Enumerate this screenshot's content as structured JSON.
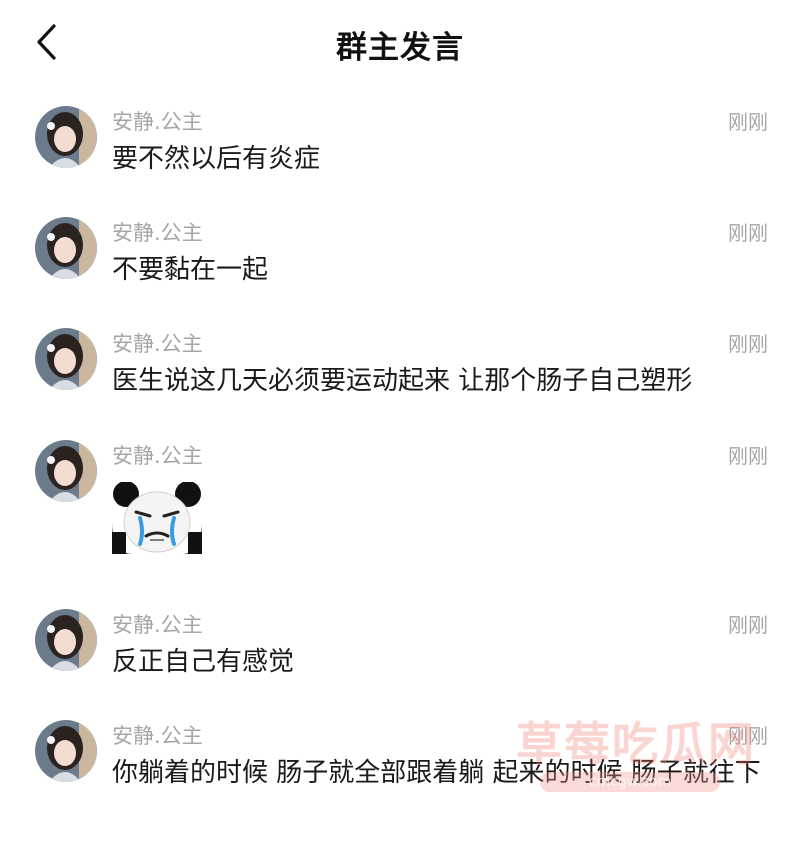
{
  "header": {
    "title": "群主发言"
  },
  "messages": [
    {
      "name": "安静.公主",
      "time": "刚刚",
      "type": "text",
      "text": "要不然以后有炎症"
    },
    {
      "name": "安静.公主",
      "time": "刚刚",
      "type": "text",
      "text": "不要黏在一起"
    },
    {
      "name": "安静.公主",
      "time": "刚刚",
      "type": "text",
      "text": "医生说这几天必须要运动起来 让那个肠子自己塑形"
    },
    {
      "name": "安静.公主",
      "time": "刚刚",
      "type": "sticker",
      "sticker": "panda-crying-meme"
    },
    {
      "name": "安静.公主",
      "time": "刚刚",
      "type": "text",
      "text": "反正自己有感觉"
    },
    {
      "name": "安静.公主",
      "time": "刚刚",
      "type": "text",
      "text": "你躺着的时候 肠子就全部跟着躺 起来的时候 肠子就往下"
    }
  ],
  "watermark": {
    "text": "草莓吃瓜网",
    "url": "cmcgw.com"
  },
  "icons": {
    "back": "chevron-left-icon",
    "avatar": "user-avatar"
  },
  "colors": {
    "meta_gray": "#a6a6a6",
    "text": "#1a1a1a",
    "background": "#ffffff",
    "watermark": "#f0786e"
  }
}
